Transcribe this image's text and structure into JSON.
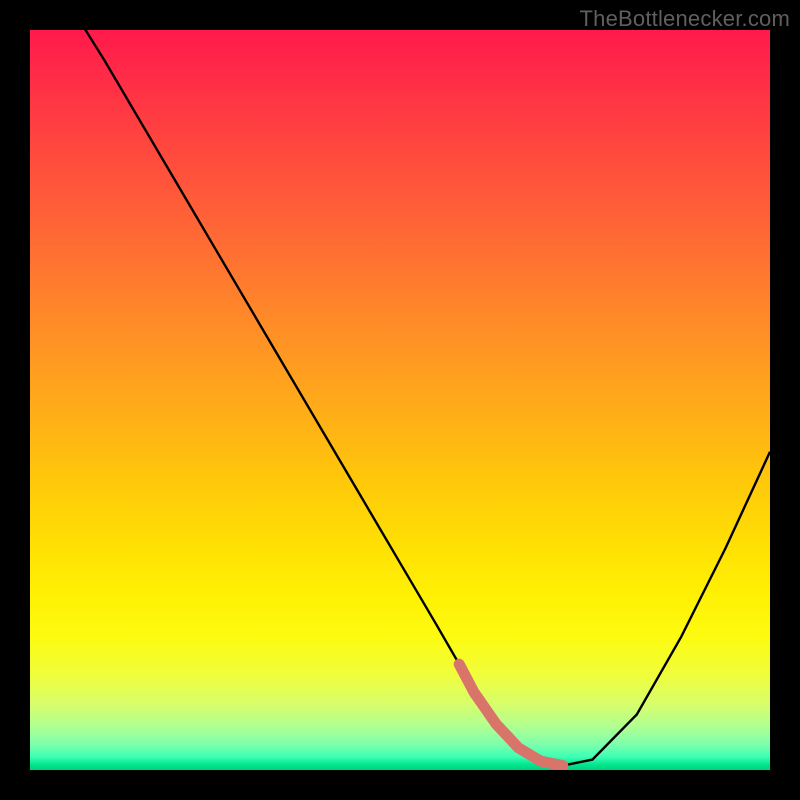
{
  "watermark": "TheBottlenecker.com",
  "chart_data": {
    "type": "line",
    "title": "",
    "xlabel": "",
    "ylabel": "",
    "xlim": [
      0,
      100
    ],
    "ylim": [
      0,
      100
    ],
    "series": [
      {
        "name": "bottleneck-curve",
        "x": [
          0,
          5,
          10,
          15,
          20,
          25,
          30,
          35,
          40,
          45,
          50,
          55,
          58,
          60,
          63,
          66,
          69,
          72,
          76,
          82,
          88,
          94,
          100
        ],
        "values": [
          112,
          104,
          96,
          87.5,
          79,
          70.5,
          62,
          53.5,
          45,
          36.5,
          28,
          19.5,
          14.3,
          10.5,
          6.2,
          3.0,
          1.2,
          0.6,
          1.4,
          7.5,
          18,
          30,
          43
        ]
      }
    ],
    "highlight_segment": {
      "name": "optimal-range",
      "color": "#d9746a",
      "x": [
        58,
        72
      ],
      "y_approx": 1.0
    },
    "background_gradient": {
      "type": "vertical",
      "stops": [
        {
          "pos": 0.0,
          "color": "#ff1a4b"
        },
        {
          "pos": 0.5,
          "color": "#ffb116"
        },
        {
          "pos": 0.8,
          "color": "#fdfb10"
        },
        {
          "pos": 0.95,
          "color": "#b2ff90"
        },
        {
          "pos": 1.0,
          "color": "#00d27b"
        }
      ]
    }
  }
}
